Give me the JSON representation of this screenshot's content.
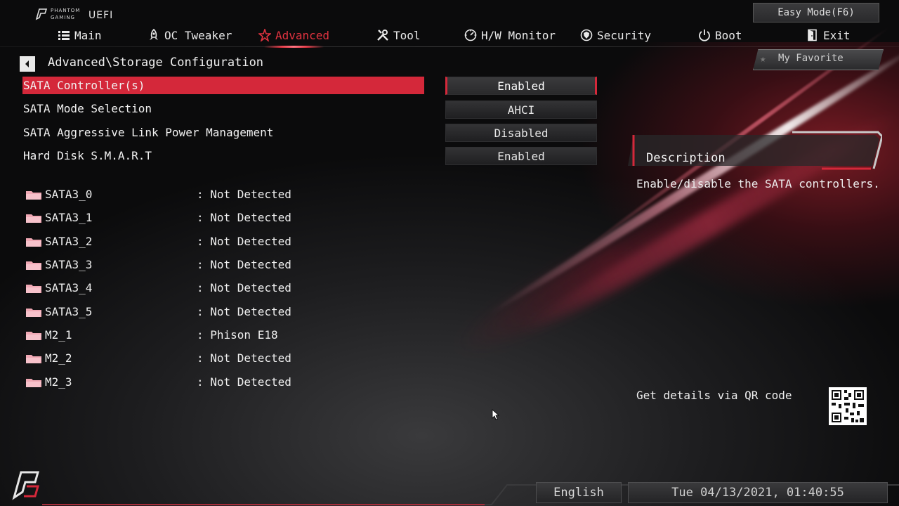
{
  "logo": {
    "line1": "PHANTOM",
    "line2": "GAMING",
    "uefi": "UEFI"
  },
  "easy_mode": "Easy Mode(F6)",
  "nav": [
    {
      "label": "Main",
      "icon": "list-icon"
    },
    {
      "label": "OC Tweaker",
      "icon": "rocket-icon"
    },
    {
      "label": "Advanced",
      "icon": "star-icon",
      "active": true
    },
    {
      "label": "Tool",
      "icon": "tools-icon"
    },
    {
      "label": "H/W Monitor",
      "icon": "gauge-icon"
    },
    {
      "label": "Security",
      "icon": "shield-icon"
    },
    {
      "label": "Boot",
      "icon": "power-icon"
    },
    {
      "label": "Exit",
      "icon": "exit-door-icon"
    }
  ],
  "breadcrumb": "Advanced\\Storage Configuration",
  "favorite": "My Favorite",
  "settings": [
    {
      "label": "SATA Controller(s)",
      "value": "Enabled",
      "selected": true
    },
    {
      "label": "SATA Mode Selection",
      "value": "AHCI"
    },
    {
      "label": "SATA Aggressive Link Power Management",
      "value": "Disabled"
    },
    {
      "label": "Hard Disk S.M.A.R.T",
      "value": "Enabled"
    }
  ],
  "devices": [
    {
      "name": "SATA3_0",
      "status": ": Not Detected"
    },
    {
      "name": "SATA3_1",
      "status": ": Not Detected"
    },
    {
      "name": "SATA3_2",
      "status": ": Not Detected"
    },
    {
      "name": "SATA3_3",
      "status": ": Not Detected"
    },
    {
      "name": "SATA3_4",
      "status": ": Not Detected"
    },
    {
      "name": "SATA3_5",
      "status": ": Not Detected"
    },
    {
      "name": "M2_1",
      "status": ": Phison E18"
    },
    {
      "name": "M2_2",
      "status": ": Not Detected"
    },
    {
      "name": "M2_3",
      "status": ": Not Detected"
    }
  ],
  "description": {
    "title": "Description",
    "text": "Enable/disable the SATA controllers."
  },
  "qr_text": "Get details via QR code",
  "language": "English",
  "datetime": "Tue 04/13/2021, 01:40:55",
  "colors": {
    "accent": "#d4283a",
    "active_nav": "#e23340",
    "background": "#0c0c0d"
  }
}
